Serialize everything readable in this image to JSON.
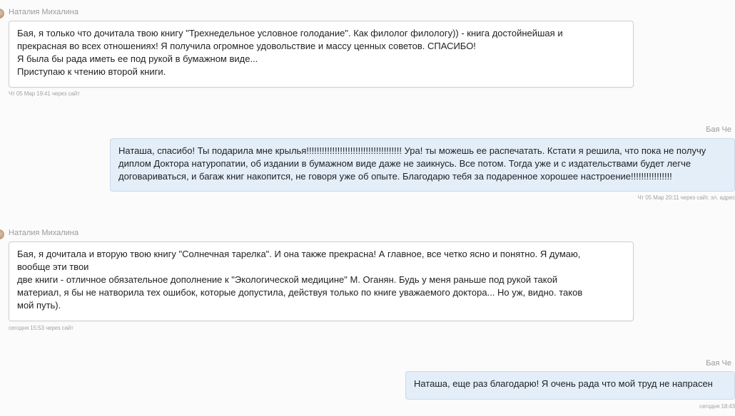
{
  "messages": [
    {
      "author": "Наталия Михалина",
      "lines": [
        "Бая, я только что дочитала твою книгу \"Трехнедельное условное голодание\". Как филолог филологу)) - книга достойнейшая и",
        "прекрасная во всех отношениях! Я получила огромное удовольствие и массу ценных советов. СПАСИБО!",
        "Я была бы рада иметь ее под рукой в бумажном виде...",
        "Приступаю к чтению второй книги."
      ],
      "meta": "Чт 05 Мар 19:41 через сайт"
    },
    {
      "author": "Бая Че",
      "lines": [
        "Наташа, спасибо! Ты подарила мне крылья!!!!!!!!!!!!!!!!!!!!!!!!!!!!!!!!!!!!! Ура! ты можешь ее распечатать. Кстати я решила, что пока не получу",
        "диплом Доктора натуропатии, об издании в бумажном виде даже не заикнусь. Все потом. Тогда уже и с издательствами будет легче",
        "договариваться, и багаж книг накопится, не говоря уже об опыте. Благодарю тебя за подаренное хорошее настроение!!!!!!!!!!!!!!!!"
      ],
      "meta": "Чт 05 Мар 20:11 через сайт, эл. адрес"
    },
    {
      "author": "Наталия Михалина",
      "lines": [
        "Бая, я дочитала и вторую твою книгу \"Солнечная тарелка\". И она также прекрасна! А главное, все четко ясно и понятно. Я думаю,",
        "вообще эти твои",
        "две книги - отличное обязательное дополнение к \"Экологической медицине\" М. Оганян. Будь у меня раньше под рукой такой",
        "материал, я бы не натворила тех ошибок, которые допустила, действуя только по книге уважаемого доктора... Но уж, видно. таков",
        "мой путь)."
      ],
      "meta": "сегодня 15:53 через сайт"
    },
    {
      "author": "Бая Че",
      "lines": [
        "Наташа, еще раз благодарю! Я очень рада что мой труд не напрасен"
      ],
      "meta": "сегодня 18:43"
    }
  ]
}
